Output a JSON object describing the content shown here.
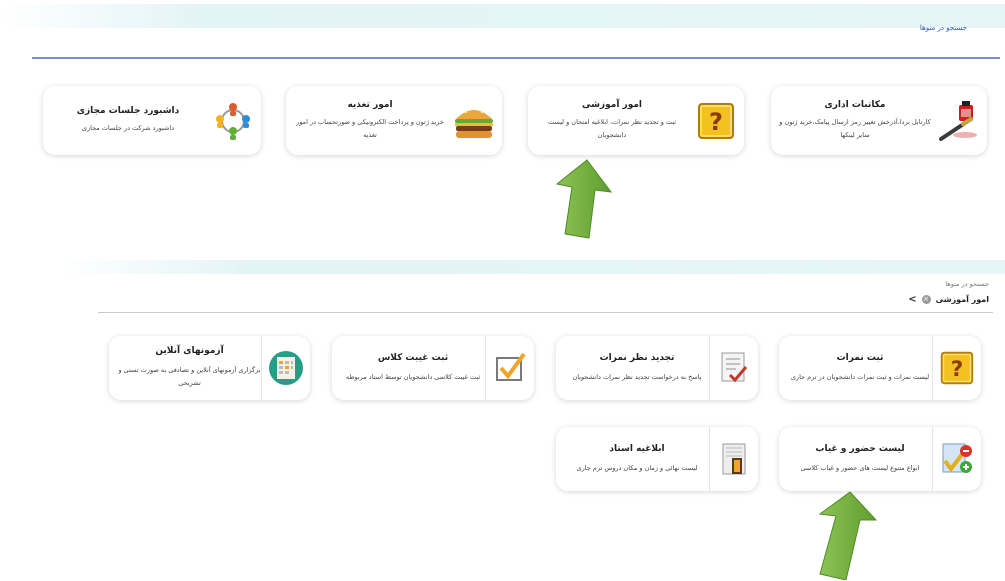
{
  "top": {
    "search_label": "جستجو در منوها",
    "cards": [
      {
        "title": "مکاتبات اداری",
        "desc": "کارتابل بردا،آذرخش تغییر رمز ارسال پیامک،خرید ژتون و سایر لینکها",
        "icon": "ink-pen-icon"
      },
      {
        "title": "امور آموزشی",
        "desc": "ثبت و تجدید نظر نمرات، ابلاغیه امتحان و لیست دانشجویان",
        "icon": "question-box-icon"
      },
      {
        "title": "امور تغذیه",
        "desc": "خرید ژتون و پرداخت الکترونیکی و صورتحساب در امور تغذیه",
        "icon": "burger-icon"
      },
      {
        "title": "داشبورد جلسات مجازی",
        "desc": "داشبورد شرکت در جلسات مجازی",
        "icon": "people-circle-icon"
      }
    ]
  },
  "bottom": {
    "search_label": "جستجو در منوها",
    "breadcrumb": "امور آموزشی",
    "cards": [
      {
        "title": "ثبت نمرات",
        "desc": "لیست نمرات و ثبت نمرات دانشجویان در ترم جاری",
        "icon": "question-box-icon"
      },
      {
        "title": "تجدید نظر نمرات",
        "desc": "پاسخ به درخواست تجدید نظر نمرات دانشجویان",
        "icon": "review-checklist-icon"
      },
      {
        "title": "ثبت غیبت کلاس",
        "desc": "ثبت غیبت کلاسی دانشجویان توسط استاد مربوطه",
        "icon": "checkbox-icon"
      },
      {
        "title": "آزمونهای آنلاین",
        "desc": "برگزاری آزمونهای آنلاین و تصادفی به صورت تستی و تشریحی",
        "icon": "calendar-sheet-icon"
      },
      {
        "title": "لیست حضور و غیاب",
        "desc": "انواع متنوع لیست های حضور و غیاب کلاسی",
        "icon": "attendance-icon"
      },
      {
        "title": "ابلاغیه استاد",
        "desc": "لیست نهائی و زمان و مکان دروس ترم جاری",
        "icon": "door-document-icon"
      }
    ]
  },
  "colors": {
    "band": "#e3f4f6",
    "link": "#2a56b8",
    "divider": "#7f8fc8",
    "arrow": "#6bab3a"
  }
}
